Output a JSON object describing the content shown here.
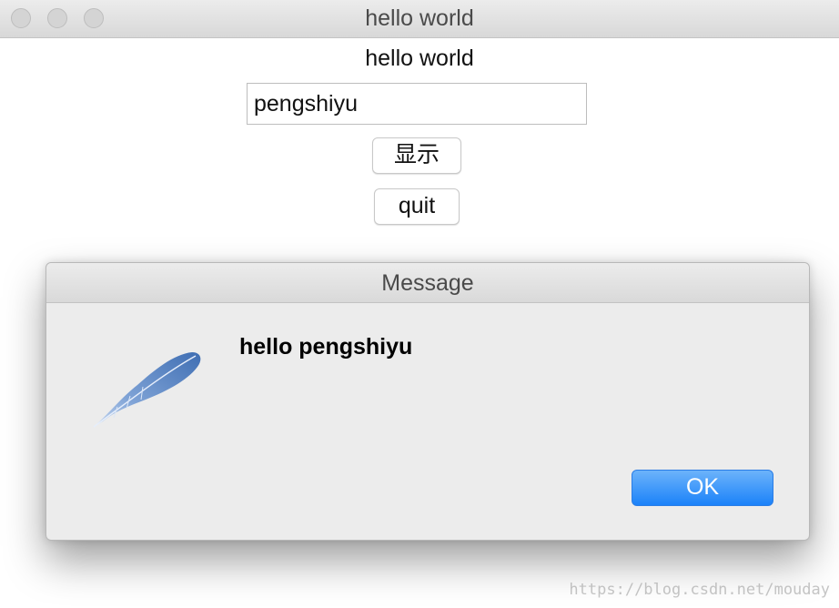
{
  "window": {
    "title": "hello world"
  },
  "main": {
    "label": "hello world",
    "name_input_value": "pengshiyu",
    "show_button_label": "显示",
    "quit_button_label": "quit"
  },
  "dialog": {
    "title": "Message",
    "message": "hello pengshiyu",
    "icon": "feather-icon",
    "ok_button_label": "OK"
  },
  "watermark": "https://blog.csdn.net/mouday",
  "colors": {
    "ok_button": "#1b82f9",
    "feather": "#4f7fc0"
  }
}
